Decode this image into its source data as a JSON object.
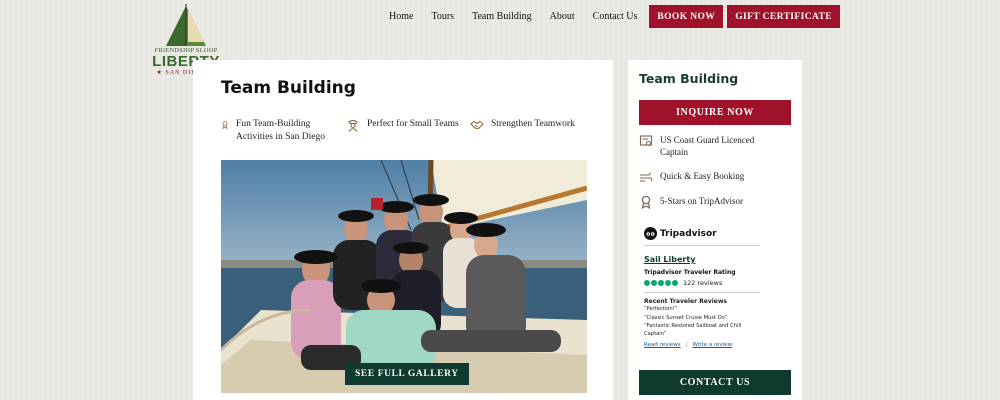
{
  "logo": {
    "line1": "FRIENDSHIP SLOOP",
    "line2": "LIBERTY",
    "line3": "★ SAN DIEGO ★"
  },
  "nav": {
    "items": [
      "Home",
      "Tours",
      "Team Building",
      "About",
      "Contact Us"
    ],
    "book_label": "BOOK NOW",
    "gift_label": "GIFT CERTIFICATE"
  },
  "main": {
    "title": "Team Building",
    "features": [
      {
        "icon": "ribbon-icon",
        "text": "Fun Team-Building Activities in San Diego"
      },
      {
        "icon": "captain-icon",
        "text": "Perfect for Small Teams"
      },
      {
        "icon": "handshake-icon",
        "text": "Strengthen Teamwork"
      }
    ],
    "gallery_label": "SEE FULL GALLERY"
  },
  "sidebar": {
    "title": "Team Building",
    "inquire_label": "INQUIRE NOW",
    "features": [
      {
        "icon": "certificate-icon",
        "text": "US Coast Guard Licenced Captain"
      },
      {
        "icon": "wind-icon",
        "text": "Quick & Easy Booking"
      },
      {
        "icon": "ribbon-icon",
        "text": "5-Stars on TripAdvisor"
      }
    ],
    "contact_label": "CONTACT US"
  },
  "tripadvisor": {
    "brand": "Tripadvisor",
    "business": "Sail Liberty",
    "rating_label": "Tripadvisor Traveler Rating",
    "rating_bubbles": 5,
    "reviews_count": "122 reviews",
    "recent_heading": "Recent Traveler Reviews",
    "reviews": [
      "“Perfection!”",
      "“Classic Sunset Cruise Must Do”",
      "“Fantastic Restored Sailboat and Chill Captain”"
    ],
    "read_link": "Read reviews",
    "write_link": "Write a review"
  },
  "colors": {
    "brand_red": "#a0112b",
    "brand_green": "#0e3a2f",
    "background": "#ecebe5"
  }
}
